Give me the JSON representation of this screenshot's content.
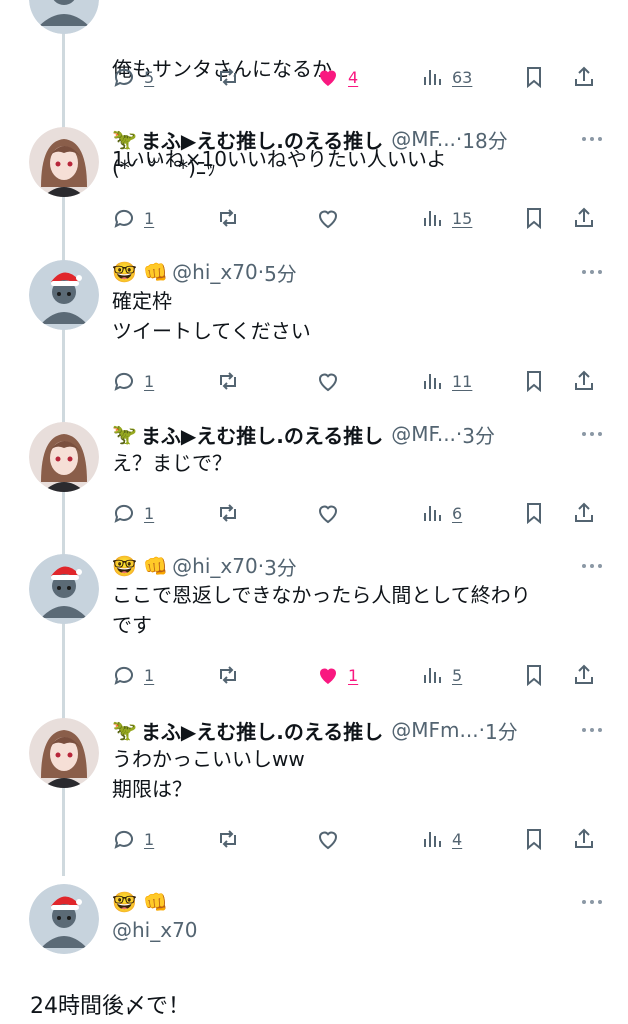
{
  "colors": {
    "like_active": "#f91880",
    "muted": "#536471",
    "thread_line": "#cfd9de"
  },
  "top_tweet": {
    "lines": [
      "俺もサンタさんになるか",
      "1いいね×10いいねやりたい人いいよ"
    ],
    "replies": "5",
    "likes": "4",
    "liked": true,
    "views": "63"
  },
  "tweets": [
    {
      "author": "mafu",
      "emoji": "🦖",
      "display_name": "まふ▶えむ推し.のえる推し",
      "handle": "@MF...",
      "time": "18分",
      "text": "(*´ ꒳ `*)ﾆｯ",
      "replies": "1",
      "likes": "",
      "liked": false,
      "views": "15"
    },
    {
      "author": "hi",
      "emoji": "🤓 👊",
      "display_name": "",
      "handle": "@hi_x70",
      "time": "5分",
      "text": "確定枠\nツイートしてください",
      "replies": "1",
      "likes": "",
      "liked": false,
      "views": "11"
    },
    {
      "author": "mafu",
      "emoji": "🦖",
      "display_name": "まふ▶えむ推し.のえる推し",
      "handle": "@MF...",
      "time": "3分",
      "text": "え？まじで？",
      "replies": "1",
      "likes": "",
      "liked": false,
      "views": "6"
    },
    {
      "author": "hi",
      "emoji": "🤓 👊",
      "display_name": "",
      "handle": "@hi_x70",
      "time": "3分",
      "text": "ここで恩返しできなかったら人間として終わり\nです",
      "replies": "1",
      "likes": "1",
      "liked": true,
      "views": "5"
    },
    {
      "author": "mafu",
      "emoji": "🦖",
      "display_name": "まふ▶えむ推し.のえる推し",
      "handle": "@MFm...",
      "time": "1分",
      "text": "うわかっこいいしww\n期限は？",
      "replies": "1",
      "likes": "",
      "liked": false,
      "views": "4"
    }
  ],
  "compose": {
    "emoji": "🤓 👊",
    "handle": "@hi_x70",
    "text": "24時間後〆で！"
  }
}
